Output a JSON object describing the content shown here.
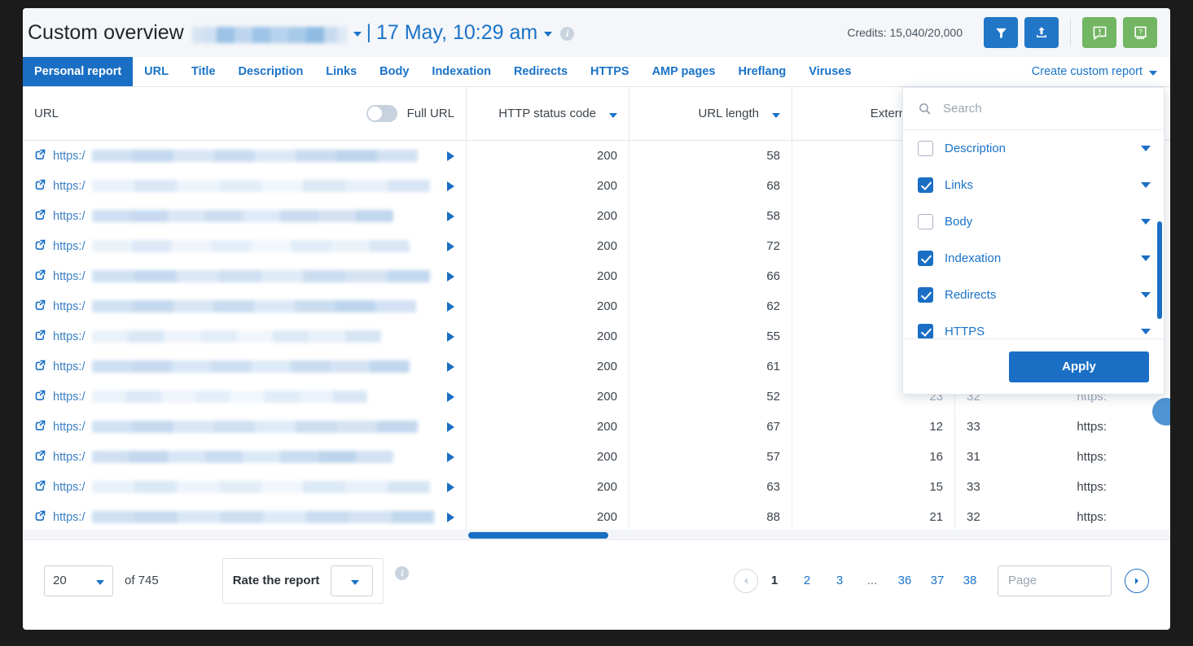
{
  "header": {
    "title": "Custom overview",
    "site_redacted": true,
    "date_label": "17 May, 10:29 am",
    "separator": "|",
    "info_icon": "info-icon",
    "credits": "Credits: 15,040/20,000",
    "buttons": [
      {
        "name": "filter-button",
        "icon": "filter-icon",
        "color": "#2176c7"
      },
      {
        "name": "export-button",
        "icon": "upload-icon",
        "color": "#2176c7"
      },
      {
        "name": "feedback-button",
        "icon": "alert-comment-icon",
        "color": "#72b562"
      },
      {
        "name": "help-button",
        "icon": "question-book-icon",
        "color": "#72b562"
      }
    ]
  },
  "tabs": {
    "items": [
      {
        "label": "Personal report",
        "active": true
      },
      {
        "label": "URL",
        "active": false
      },
      {
        "label": "Title",
        "active": false
      },
      {
        "label": "Description",
        "active": false
      },
      {
        "label": "Links",
        "active": false
      },
      {
        "label": "Body",
        "active": false
      },
      {
        "label": "Indexation",
        "active": false
      },
      {
        "label": "Redirects",
        "active": false
      },
      {
        "label": "HTTPS",
        "active": false
      },
      {
        "label": "AMP pages",
        "active": false
      },
      {
        "label": "Hreflang",
        "active": false
      },
      {
        "label": "Viruses",
        "active": false
      }
    ],
    "create_report_label": "Create custom report"
  },
  "table": {
    "columns": [
      {
        "label": "URL",
        "sortable": false
      },
      {
        "label": "HTTP status code",
        "sortable": true
      },
      {
        "label": "URL length",
        "sortable": true
      },
      {
        "label": "External links",
        "sortable": false
      }
    ],
    "full_url_toggle": {
      "label": "Full URL",
      "on": false
    },
    "url_prefix": "https:/",
    "rows": [
      {
        "status": "200",
        "url_length": "58",
        "external_links": "",
        "col5": ""
      },
      {
        "status": "200",
        "url_length": "68",
        "external_links": "",
        "col5": ""
      },
      {
        "status": "200",
        "url_length": "58",
        "external_links": "",
        "col5": ""
      },
      {
        "status": "200",
        "url_length": "72",
        "external_links": "",
        "col5": ""
      },
      {
        "status": "200",
        "url_length": "66",
        "external_links": "",
        "col5": ""
      },
      {
        "status": "200",
        "url_length": "62",
        "external_links": "",
        "col5": ""
      },
      {
        "status": "200",
        "url_length": "55",
        "external_links": "",
        "col5": ""
      },
      {
        "status": "200",
        "url_length": "61",
        "external_links": "",
        "col5": ""
      },
      {
        "status": "200",
        "url_length": "52",
        "external_links": "23",
        "col5": "32",
        "col6": "https:"
      },
      {
        "status": "200",
        "url_length": "67",
        "external_links": "12",
        "col5": "33",
        "col6": "https:"
      },
      {
        "status": "200",
        "url_length": "57",
        "external_links": "16",
        "col5": "31",
        "col6": "https:"
      },
      {
        "status": "200",
        "url_length": "63",
        "external_links": "15",
        "col5": "33",
        "col6": "https:"
      },
      {
        "status": "200",
        "url_length": "88",
        "external_links": "21",
        "col5": "32",
        "col6": "https:"
      }
    ]
  },
  "dropdown": {
    "search_placeholder": "Search",
    "search_value": "",
    "search_icon": "search-icon",
    "items": [
      {
        "label": "Description",
        "checked": false
      },
      {
        "label": "Links",
        "checked": true
      },
      {
        "label": "Body",
        "checked": false
      },
      {
        "label": "Indexation",
        "checked": true
      },
      {
        "label": "Redirects",
        "checked": true
      },
      {
        "label": "HTTPS",
        "checked": true
      }
    ],
    "apply_label": "Apply"
  },
  "footer": {
    "per_page": "20",
    "of_total": "of 745",
    "rate_label": "Rate the report",
    "rate_value": "",
    "info_icon": "info-icon",
    "pagination": {
      "pages": [
        {
          "label": "1",
          "current": true
        },
        {
          "label": "2",
          "current": false
        },
        {
          "label": "3",
          "current": false
        },
        {
          "label": "...",
          "current": false,
          "dots": true
        },
        {
          "label": "36",
          "current": false
        },
        {
          "label": "37",
          "current": false
        },
        {
          "label": "38",
          "current": false
        }
      ],
      "page_input_placeholder": "Page",
      "page_input_value": ""
    }
  },
  "colors": {
    "brand_blue": "#1a6fc4",
    "link_blue": "#1a73c8",
    "green": "#72b562",
    "header_bg": "#f4f6f9"
  }
}
